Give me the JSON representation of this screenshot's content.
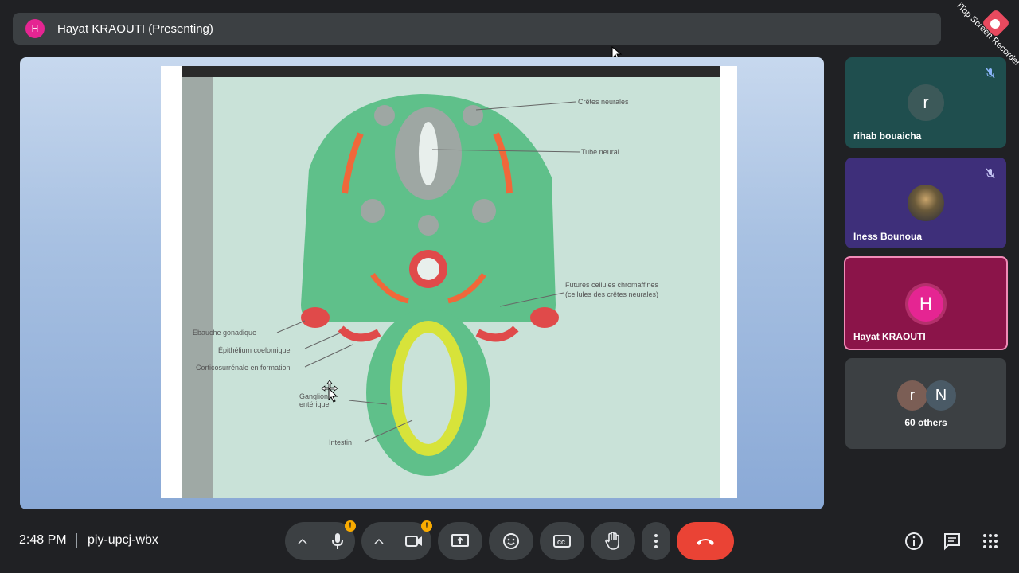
{
  "presenter_bar": {
    "avatar_letter": "H",
    "title": "Hayat KRAOUTI (Presenting)"
  },
  "watermark": "iTop Screen Recorder",
  "slide": {
    "labels": {
      "top_right_1": "Crêtes neurales",
      "top_right_2": "Tube neural",
      "right_mid_1": "Futures cellules chromaffines",
      "right_mid_2": "(cellules des crêtes neurales)",
      "left_1": "Ébauche gonadique",
      "left_2": "Épithélium coelomique",
      "left_3": "Corticosurrénale en formation",
      "left_4": "Ganglion entérique",
      "bottom": "Intestin"
    }
  },
  "participants": [
    {
      "letter": "r",
      "name": "rihab bouaicha",
      "muted": true,
      "color": "#1f4e4e"
    },
    {
      "letter": "",
      "name": "Iness Bounoua",
      "muted": true,
      "color": "#3e2f7a"
    },
    {
      "letter": "H",
      "name": "Hayat KRAOUTI",
      "muted": false,
      "color": "#8b1449",
      "active": true
    },
    {
      "name": "60 others",
      "avatars": [
        "r",
        "N"
      ]
    }
  ],
  "bottom_bar": {
    "time": "2:48 PM",
    "meeting_code": "piy-upcj-wbx"
  },
  "colors": {
    "end_call": "#ea4335",
    "warning": "#f9ab00",
    "active_tile": "#8b1449"
  }
}
